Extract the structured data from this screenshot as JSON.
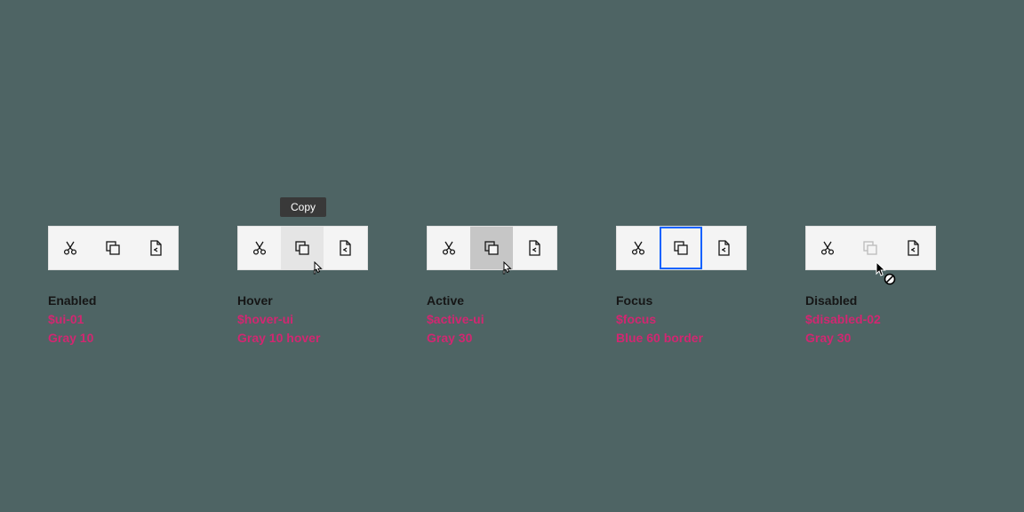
{
  "tooltip": "Copy",
  "states": [
    {
      "title": "Enabled",
      "token": "$ui-01",
      "desc": "Gray 10"
    },
    {
      "title": "Hover",
      "token": "$hover-ui",
      "desc": "Gray 10 hover"
    },
    {
      "title": "Active",
      "token": "$active-ui",
      "desc": "Gray 30"
    },
    {
      "title": "Focus",
      "token": "$focus",
      "desc": "Blue 60 border"
    },
    {
      "title": "Disabled",
      "token": "$disabled-02",
      "desc": "Gray 30"
    }
  ]
}
